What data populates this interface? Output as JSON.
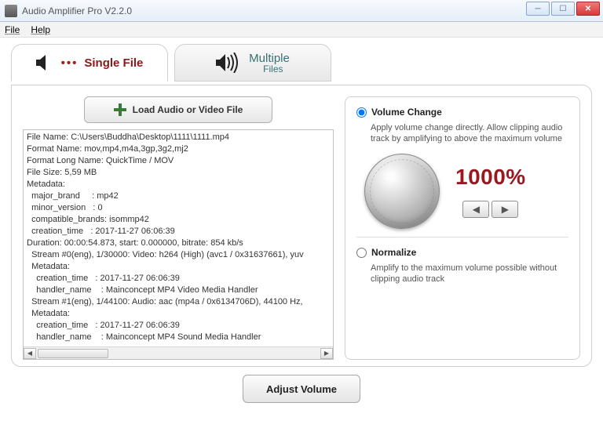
{
  "window": {
    "title": "Audio Amplifier Pro V2.2.0"
  },
  "menu": {
    "file": "File",
    "help": "Help"
  },
  "tabs": {
    "single": "Single File",
    "multipleTop": "Multiple",
    "multipleSub": "Files"
  },
  "buttons": {
    "load": "Load Audio or Video File",
    "adjust": "Adjust Volume"
  },
  "options": {
    "volumeChange": {
      "title": "Volume Change",
      "desc": "Apply volume change directly. Allow clipping audio track by amplifying to above the maximum volume"
    },
    "normalize": {
      "title": "Normalize",
      "desc": "Amplify to the maximum volume possible without clipping audio track"
    },
    "percent": "1000%"
  },
  "fileinfo": {
    "l0": "File Name: C:\\Users\\Buddha\\Desktop\\1111\\1111.mp4",
    "l1": "Format Name: mov,mp4,m4a,3gp,3g2,mj2",
    "l2": "Format Long Name: QuickTime / MOV",
    "l3": "File Size: 5,59 MB",
    "l4": "Metadata:",
    "l5": "  major_brand     : mp42",
    "l6": "  minor_version   : 0",
    "l7": "  compatible_brands: isommp42",
    "l8": "  creation_time   : 2017-11-27 06:06:39",
    "l9": "Duration: 00:00:54.873, start: 0.000000, bitrate: 854 kb/s",
    "l10": "  Stream #0(eng), 1/30000: Video: h264 (High) (avc1 / 0x31637661), yuv",
    "l11": "  Metadata:",
    "l12": "    creation_time   : 2017-11-27 06:06:39",
    "l13": "    handler_name    : Mainconcept MP4 Video Media Handler",
    "l14": "  Stream #1(eng), 1/44100: Audio: aac (mp4a / 0x6134706D), 44100 Hz,",
    "l15": "  Metadata:",
    "l16": "    creation_time   : 2017-11-27 06:06:39",
    "l17": "    handler_name    : Mainconcept MP4 Sound Media Handler"
  }
}
